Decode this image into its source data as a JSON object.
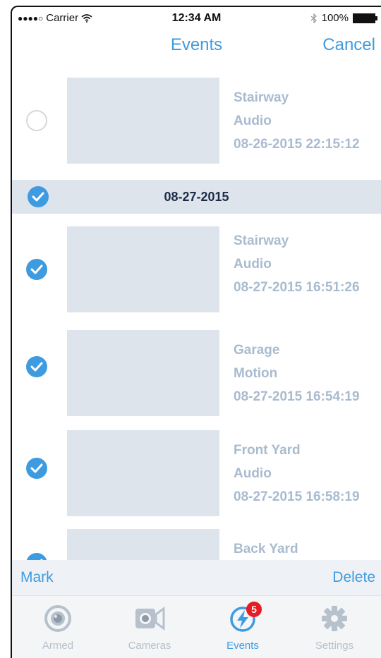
{
  "status_bar": {
    "carrier": "Carrier",
    "time": "12:34 AM",
    "battery": "100%"
  },
  "nav": {
    "title": "Events",
    "cancel": "Cancel"
  },
  "events_top": [
    {
      "camera": "Stairway",
      "type": "Audio",
      "timestamp": "08-26-2015 22:15:12",
      "checked": false
    }
  ],
  "section": {
    "date": "08-27-2015",
    "checked": true
  },
  "events": [
    {
      "camera": "Stairway",
      "type": "Audio",
      "timestamp": "08-27-2015 16:51:26",
      "checked": true
    },
    {
      "camera": "Garage",
      "type": "Motion",
      "timestamp": "08-27-2015 16:54:19",
      "checked": true
    },
    {
      "camera": "Front Yard",
      "type": "Audio",
      "timestamp": "08-27-2015 16:58:19",
      "checked": true
    },
    {
      "camera": "Back Yard",
      "type": "",
      "timestamp": "",
      "checked": true
    }
  ],
  "actions": {
    "mark": "Mark",
    "delete": "Delete"
  },
  "tabs": [
    {
      "label": "Armed",
      "icon": "armed-icon"
    },
    {
      "label": "Cameras",
      "icon": "camera-icon"
    },
    {
      "label": "Events",
      "icon": "events-bolt-icon",
      "badge": "5",
      "active": true
    },
    {
      "label": "Settings",
      "icon": "gear-icon"
    }
  ],
  "colors": {
    "accent": "#3f9be0",
    "meta_text": "#a9bbcf",
    "thumb": "#dde4ec",
    "badge": "#e51c23"
  }
}
